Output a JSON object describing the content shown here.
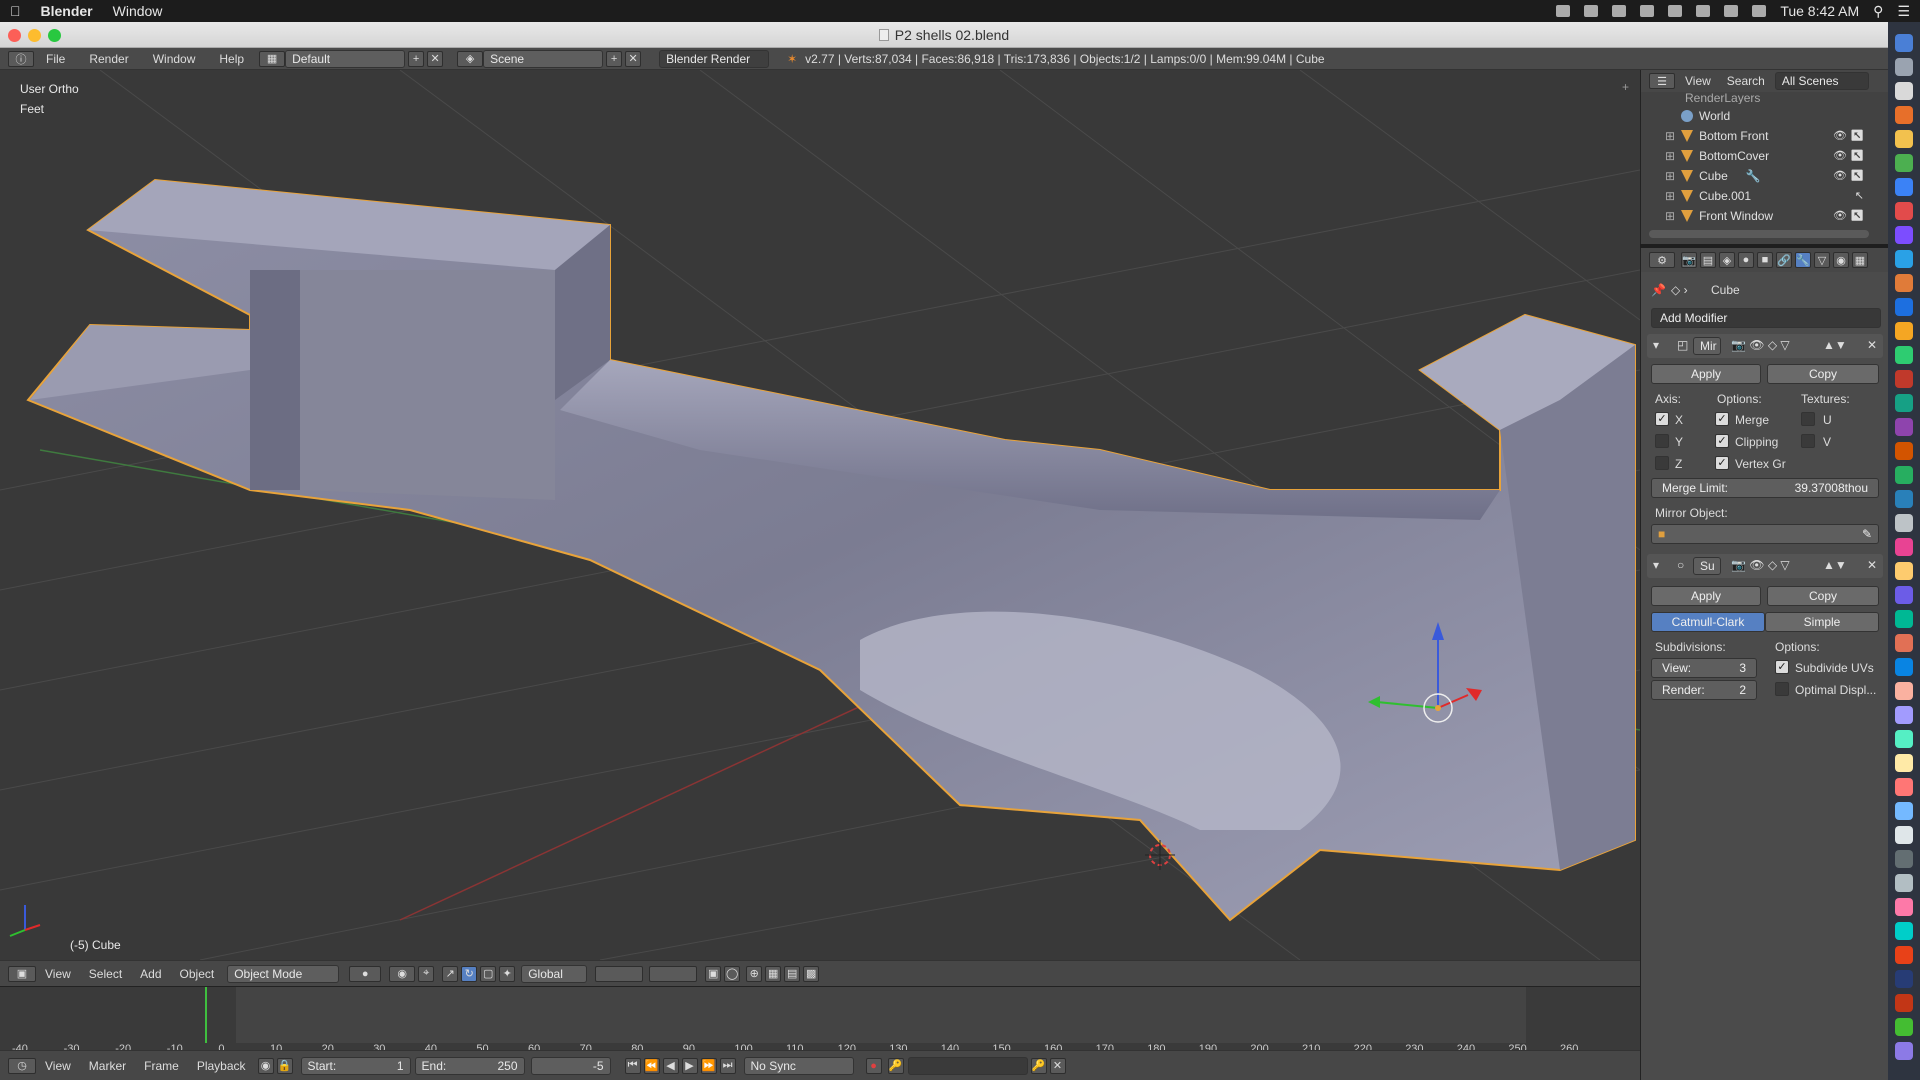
{
  "menubar": {
    "app": "Blender",
    "items": [
      "Window"
    ],
    "clock": "Tue 8:42 AM"
  },
  "window": {
    "title": "P2 shells 02.blend"
  },
  "info_header": {
    "menus": [
      "File",
      "Render",
      "Window",
      "Help"
    ],
    "layout": "Default",
    "scene": "Scene",
    "engine": "Blender Render",
    "stats": "v2.77 | Verts:87,034 | Faces:86,918 | Tris:173,836 | Objects:1/2 | Lamps:0/0 | Mem:99.04M | Cube"
  },
  "viewport": {
    "view_name": "User Ortho",
    "units": "Feet",
    "object_label": "(-5) Cube"
  },
  "view3d_header": {
    "menus": [
      "View",
      "Select",
      "Add",
      "Object"
    ],
    "mode": "Object Mode",
    "orientation": "Global"
  },
  "timeline": {
    "ticks": [
      "-40",
      "-30",
      "-20",
      "-10",
      "0",
      "10",
      "20",
      "30",
      "40",
      "50",
      "60",
      "70",
      "80",
      "90",
      "100",
      "110",
      "120",
      "130",
      "140",
      "150",
      "160",
      "170",
      "180",
      "190",
      "200",
      "210",
      "220",
      "230",
      "240",
      "250",
      "260"
    ],
    "menus": [
      "View",
      "Marker",
      "Frame",
      "Playback"
    ],
    "start_label": "Start:",
    "start": "1",
    "end_label": "End:",
    "end": "250",
    "current": "-5",
    "sync": "No Sync"
  },
  "outliner": {
    "menus": [
      "View",
      "Search"
    ],
    "filter": "All Scenes",
    "items": [
      "RenderLayers",
      "World",
      "Bottom Front",
      "BottomCover",
      "Cube",
      "Cube.001",
      "Front Window"
    ]
  },
  "properties": {
    "context": "Cube",
    "add_modifier": "Add Modifier",
    "mirror": {
      "name": "Mir",
      "apply": "Apply",
      "copy": "Copy",
      "axis_label": "Axis:",
      "options_label": "Options:",
      "textures_label": "Textures:",
      "axis_x": "X",
      "axis_y": "Y",
      "axis_z": "Z",
      "merge": "Merge",
      "clipping": "Clipping",
      "vertex_gr": "Vertex Gr",
      "tex_u": "U",
      "tex_v": "V",
      "merge_limit_label": "Merge Limit:",
      "merge_limit_value": "39.37008thou",
      "mirror_object_label": "Mirror Object:"
    },
    "subsurf": {
      "name": "Su",
      "apply": "Apply",
      "copy": "Copy",
      "catmull": "Catmull-Clark",
      "simple": "Simple",
      "subdivisions_label": "Subdivisions:",
      "options_label": "Options:",
      "view_label": "View:",
      "view_value": "3",
      "render_label": "Render:",
      "render_value": "2",
      "subdivide_uvs": "Subdivide UVs",
      "optimal_display": "Optimal Displ..."
    }
  },
  "colors": {
    "accent_blue": "#5680c2",
    "selection_orange": "#e8a33a",
    "viewport_bg": "#393939"
  }
}
